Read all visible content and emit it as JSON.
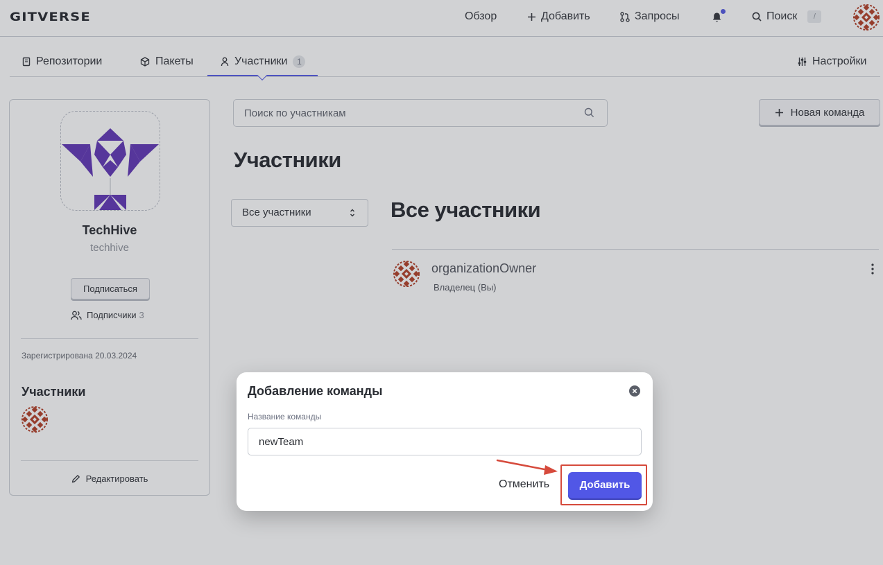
{
  "header": {
    "logo": "GITVERSE",
    "nav": {
      "overview": "Обзор",
      "add": "Добавить",
      "requests": "Запросы",
      "search": "Поиск",
      "search_shortcut": "/"
    }
  },
  "tabs": {
    "repositories": "Репозитории",
    "packages": "Пакеты",
    "members": "Участники",
    "members_count": "1",
    "settings": "Настройки"
  },
  "org": {
    "name": "TechHive",
    "handle": "techhive",
    "subscribe": "Подписаться",
    "followers_label": "Подписчики",
    "followers_count": "3",
    "registered": "Зарегистрирована 20.03.2024",
    "members_heading": "Участники",
    "edit": "Редактировать"
  },
  "main": {
    "search_placeholder": "Поиск по участникам",
    "new_team": "Новая команда",
    "title": "Участники",
    "filter_selected": "Все участники",
    "section_title": "Все участники",
    "members": [
      {
        "name": "organizationOwner",
        "role": "Владелец (Вы)"
      }
    ]
  },
  "modal": {
    "title": "Добавление команды",
    "field_label": "Название команды",
    "field_value": "newTeam",
    "cancel": "Отменить",
    "submit": "Добавить"
  },
  "colors": {
    "accent": "#5157e6",
    "highlight": "#d64a3c",
    "org_logo": "#5b2fb3",
    "avatar": "#b0381f"
  }
}
